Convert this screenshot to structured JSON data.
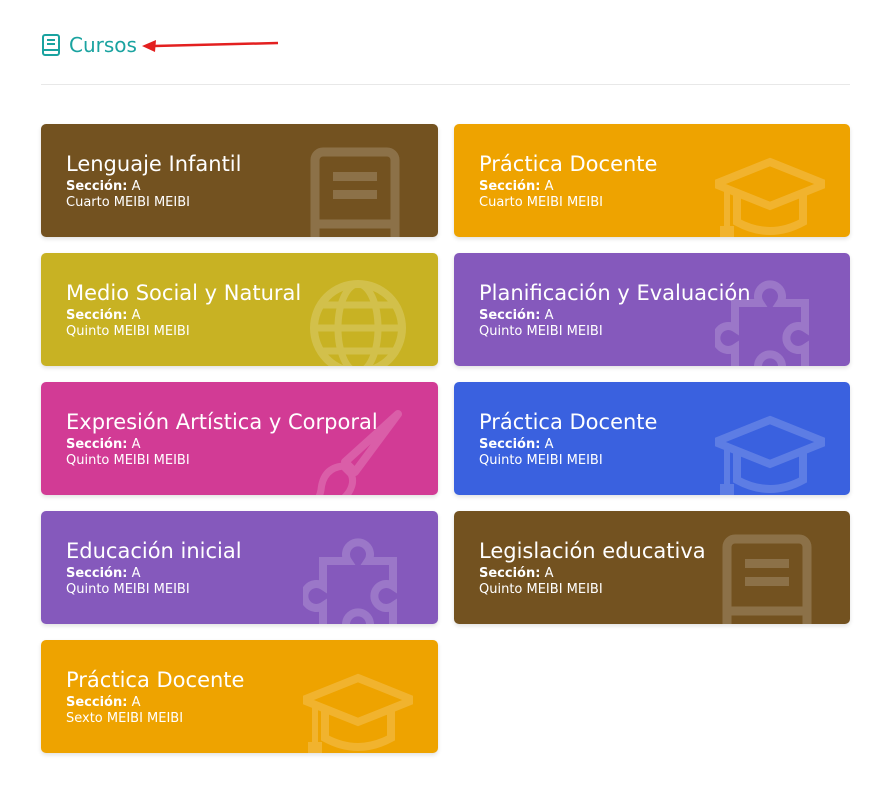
{
  "header": {
    "title": "Cursos",
    "icon": "book-icon",
    "accent_color": "#1aa3a0"
  },
  "courses": [
    {
      "name": "Lenguaje Infantil",
      "section_label": "Sección:",
      "section": "A",
      "grade": "Cuarto MEIBI MEIBI",
      "color": "#735220",
      "icon": "book-icon"
    },
    {
      "name": "Práctica Docente",
      "section_label": "Sección:",
      "section": "A",
      "grade": "Cuarto MEIBI MEIBI",
      "color": "#eea300",
      "icon": "graduation-cap-icon"
    },
    {
      "name": "Medio Social y Natural",
      "section_label": "Sección:",
      "section": "A",
      "grade": "Quinto MEIBI MEIBI",
      "color": "#c8b223",
      "icon": "globe-icon"
    },
    {
      "name": "Planificación y Evaluación",
      "section_label": "Sección:",
      "section": "A",
      "grade": "Quinto MEIBI MEIBI",
      "color": "#8559bc",
      "icon": "puzzle-icon"
    },
    {
      "name": "Expresión Artística y Corporal",
      "section_label": "Sección:",
      "section": "A",
      "grade": "Quinto MEIBI MEIBI",
      "color": "#d23b95",
      "icon": "paintbrush-icon"
    },
    {
      "name": "Práctica Docente",
      "section_label": "Sección:",
      "section": "A",
      "grade": "Quinto MEIBI MEIBI",
      "color": "#3a61df",
      "icon": "graduation-cap-icon"
    },
    {
      "name": "Educación inicial",
      "section_label": "Sección:",
      "section": "A",
      "grade": "Quinto MEIBI MEIBI",
      "color": "#8559bc",
      "icon": "puzzle-icon"
    },
    {
      "name": "Legislación educativa",
      "section_label": "Sección:",
      "section": "A",
      "grade": "Quinto MEIBI MEIBI",
      "color": "#735220",
      "icon": "book-icon"
    },
    {
      "name": "Práctica Docente",
      "section_label": "Sección:",
      "section": "A",
      "grade": "Sexto MEIBI MEIBI",
      "color": "#eea300",
      "icon": "graduation-cap-icon"
    }
  ]
}
